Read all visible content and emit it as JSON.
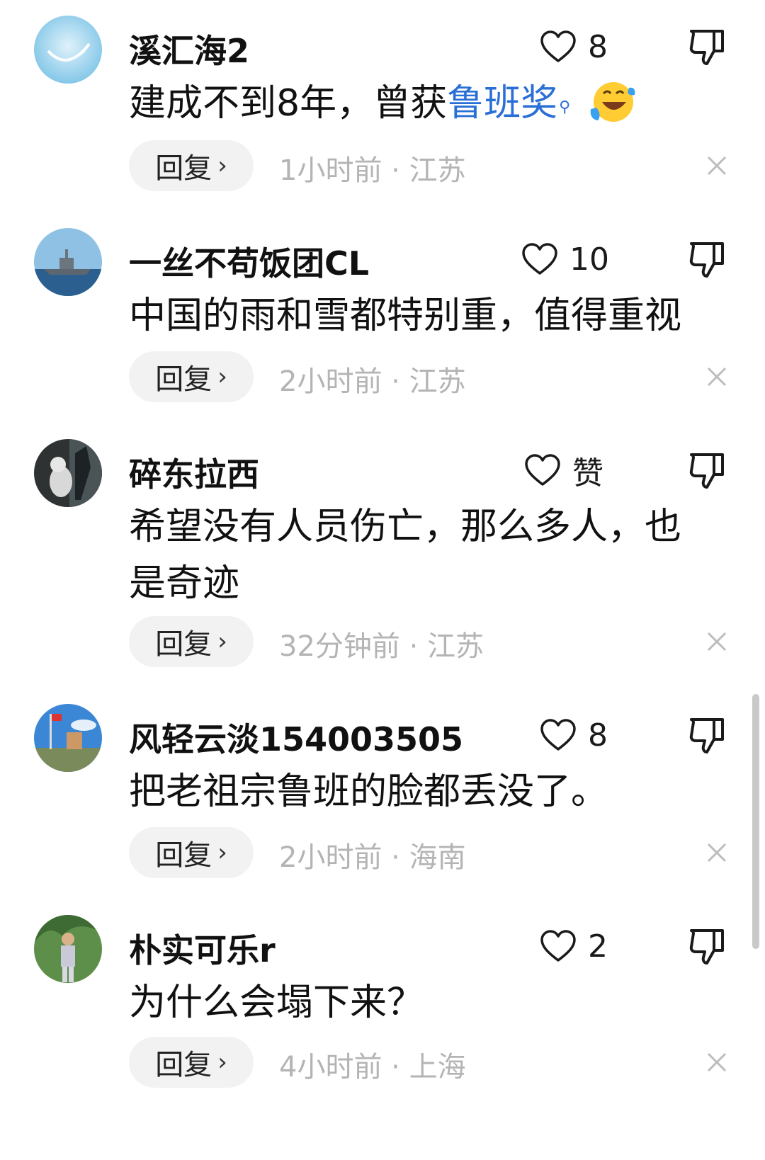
{
  "comments": [
    {
      "username": "溪汇海2",
      "likes": "8",
      "text_before": "建成不到8年，曾获",
      "link": "鲁班奖",
      "has_emoji": true,
      "reply_label": "回复",
      "time": "1小时前",
      "location": "江苏",
      "avatar": "sky-avatar"
    },
    {
      "username": "一丝不苟饭团CL",
      "likes": "10",
      "text": "中国的雨和雪都特别重，值得重视",
      "reply_label": "回复",
      "time": "2小时前",
      "location": "江苏",
      "avatar": "warship-avatar"
    },
    {
      "username": "碎东拉西",
      "likes": "赞",
      "text": "希望没有人员伤亡，那么多人，也是奇迹",
      "reply_label": "回复",
      "time": "32分钟前",
      "location": "江苏",
      "avatar": "statue-avatar"
    },
    {
      "username": "风轻云淡154003505",
      "likes": "8",
      "text": "把老祖宗鲁班的脸都丢没了。",
      "reply_label": "回复",
      "time": "2小时前",
      "location": "海南",
      "avatar": "flags-avatar"
    },
    {
      "username": "朴实可乐r",
      "likes": "2",
      "text": "为什么会塌下来？",
      "reply_label": "回复",
      "time": "4小时前",
      "location": "上海",
      "avatar": "person-avatar"
    }
  ],
  "colors": {
    "link": "#2a6fd6",
    "meta": "#b4b4b4",
    "reply_bg": "#f2f2f2"
  }
}
